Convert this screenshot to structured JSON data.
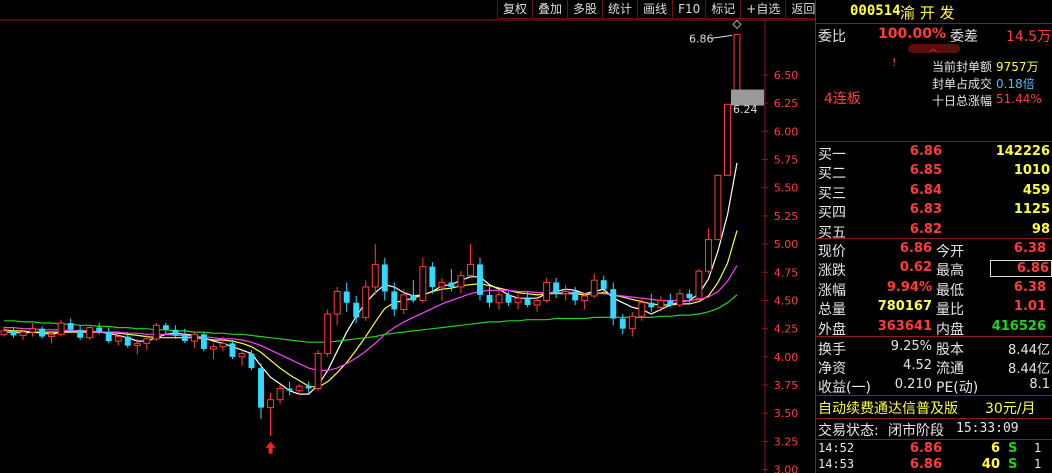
{
  "toolbar": [
    "复权",
    "叠加",
    "多股",
    "统计",
    "画线",
    "F10",
    "标记",
    "+自选",
    "返回"
  ],
  "stock": {
    "code": "000514",
    "name": "渝 开 发"
  },
  "weibi": {
    "label1": "委比",
    "value1": "100.00%",
    "label2": "委差",
    "value2": "14.5万"
  },
  "seal": {
    "board": "4连板",
    "rows": [
      {
        "label": "当前封单额",
        "value": "9757万",
        "color": "yel"
      },
      {
        "label": "封单占成交",
        "value": "0.18倍",
        "color": "cyn"
      },
      {
        "label": "十日总涨幅",
        "value": "51.44%",
        "color": "red"
      }
    ]
  },
  "bids": [
    {
      "label": "买一",
      "price": "6.86",
      "vol": "142226"
    },
    {
      "label": "买二",
      "price": "6.85",
      "vol": "1010"
    },
    {
      "label": "买三",
      "price": "6.84",
      "vol": "459"
    },
    {
      "label": "买四",
      "price": "6.83",
      "vol": "1125"
    },
    {
      "label": "买五",
      "price": "6.82",
      "vol": "98"
    }
  ],
  "quote": [
    {
      "l1": "现价",
      "v1": "6.86",
      "c1": "red",
      "l2": "今开",
      "v2": "6.38",
      "c2": "red"
    },
    {
      "l1": "涨跌",
      "v1": "0.62",
      "c1": "red",
      "l2": "最高",
      "v2": "6.86",
      "c2": "red",
      "box": true
    },
    {
      "l1": "涨幅",
      "v1": "9.94%",
      "c1": "red",
      "l2": "最低",
      "v2": "6.38",
      "c2": "red"
    },
    {
      "l1": "总量",
      "v1": "780167",
      "c1": "yel",
      "l2": "量比",
      "v2": "1.01",
      "c2": "red"
    },
    {
      "l1": "外盘",
      "v1": "363641",
      "c1": "red",
      "l2": "内盘",
      "v2": "416526",
      "c2": "grn"
    }
  ],
  "stats": [
    {
      "l1": "换手",
      "v1": "9.25%",
      "l2": "股本",
      "v2": "8.44亿"
    },
    {
      "l1": "净资",
      "v1": "4.52",
      "l2": "流通",
      "v2": "8.44亿"
    },
    {
      "l1": "收益(一)",
      "v1": "0.210",
      "l2": "PE(动)",
      "v2": "8.1"
    }
  ],
  "promo": {
    "text": "自动续费通达信普及版",
    "price": "30元/月"
  },
  "status": {
    "label": "交易状态:",
    "value": "闭市阶段",
    "time": "15:33:09"
  },
  "ticks": [
    {
      "time": "14:52",
      "price": "6.86",
      "vol": "6",
      "side": "S",
      "dir": "1"
    },
    {
      "time": "14:53",
      "price": "6.86",
      "vol": "40",
      "side": "S",
      "dir": "1"
    }
  ],
  "chart_data": {
    "type": "candlestick",
    "y_ticks": [
      "6.50",
      "6.25",
      "6.00",
      "5.75",
      "5.50",
      "5.25",
      "5.00",
      "4.75",
      "4.50",
      "4.25",
      "4.00",
      "3.75",
      "3.50",
      "3.25",
      "3.00"
    ],
    "ylim": [
      2.97,
      6.97
    ],
    "high_label": "6.86",
    "close_tag": "6.24",
    "candles": [
      [
        4.2,
        4.27,
        4.18,
        4.23
      ],
      [
        4.23,
        4.26,
        4.17,
        4.19
      ],
      [
        4.19,
        4.24,
        4.15,
        4.22
      ],
      [
        4.22,
        4.3,
        4.18,
        4.25
      ],
      [
        4.25,
        4.27,
        4.16,
        4.18
      ],
      [
        4.18,
        4.23,
        4.12,
        4.2
      ],
      [
        4.2,
        4.33,
        4.18,
        4.3
      ],
      [
        4.3,
        4.34,
        4.22,
        4.24
      ],
      [
        4.24,
        4.28,
        4.15,
        4.17
      ],
      [
        4.17,
        4.28,
        4.15,
        4.26
      ],
      [
        4.26,
        4.3,
        4.2,
        4.22
      ],
      [
        4.22,
        4.26,
        4.12,
        4.14
      ],
      [
        4.14,
        4.2,
        4.1,
        4.18
      ],
      [
        4.18,
        4.22,
        4.08,
        4.1
      ],
      [
        4.1,
        4.16,
        4.02,
        4.12
      ],
      [
        4.12,
        4.2,
        4.06,
        4.16
      ],
      [
        4.16,
        4.3,
        4.14,
        4.28
      ],
      [
        4.28,
        4.3,
        4.2,
        4.24
      ],
      [
        4.24,
        4.28,
        4.16,
        4.19
      ],
      [
        4.19,
        4.25,
        4.12,
        4.14
      ],
      [
        4.14,
        4.22,
        4.08,
        4.2
      ],
      [
        4.2,
        4.22,
        4.05,
        4.07
      ],
      [
        4.07,
        4.12,
        3.98,
        4.09
      ],
      [
        4.09,
        4.18,
        4.05,
        4.12
      ],
      [
        4.12,
        4.15,
        3.98,
        4.0
      ],
      [
        4.0,
        4.06,
        3.92,
        4.03
      ],
      [
        4.03,
        4.06,
        3.88,
        3.9
      ],
      [
        3.9,
        3.94,
        3.45,
        3.55
      ],
      [
        3.55,
        3.68,
        3.3,
        3.62
      ],
      [
        3.62,
        3.75,
        3.58,
        3.72
      ],
      [
        3.72,
        3.78,
        3.66,
        3.7
      ],
      [
        3.7,
        3.76,
        3.66,
        3.74
      ],
      [
        3.74,
        3.78,
        3.68,
        3.72
      ],
      [
        3.72,
        4.06,
        3.7,
        4.03
      ],
      [
        4.03,
        4.42,
        4.0,
        4.38
      ],
      [
        4.38,
        4.62,
        4.28,
        4.58
      ],
      [
        4.58,
        4.66,
        4.4,
        4.48
      ],
      [
        4.48,
        4.54,
        4.3,
        4.35
      ],
      [
        4.35,
        4.68,
        4.32,
        4.62
      ],
      [
        4.62,
        5.0,
        4.55,
        4.82
      ],
      [
        4.82,
        4.88,
        4.5,
        4.58
      ],
      [
        4.58,
        4.66,
        4.36,
        4.42
      ],
      [
        4.42,
        4.6,
        4.38,
        4.55
      ],
      [
        4.55,
        4.68,
        4.48,
        4.5
      ],
      [
        4.5,
        4.88,
        4.48,
        4.8
      ],
      [
        4.8,
        4.84,
        4.56,
        4.62
      ],
      [
        4.62,
        4.7,
        4.5,
        4.66
      ],
      [
        4.66,
        4.78,
        4.58,
        4.62
      ],
      [
        4.62,
        4.76,
        4.56,
        4.72
      ],
      [
        4.72,
        5.0,
        4.7,
        4.82
      ],
      [
        4.82,
        4.88,
        4.5,
        4.55
      ],
      [
        4.55,
        4.62,
        4.44,
        4.48
      ],
      [
        4.48,
        4.6,
        4.42,
        4.55
      ],
      [
        4.55,
        4.58,
        4.45,
        4.48
      ],
      [
        4.48,
        4.56,
        4.42,
        4.52
      ],
      [
        4.52,
        4.58,
        4.44,
        4.46
      ],
      [
        4.46,
        4.52,
        4.4,
        4.5
      ],
      [
        4.5,
        4.7,
        4.48,
        4.66
      ],
      [
        4.66,
        4.7,
        4.52,
        4.56
      ],
      [
        4.56,
        4.64,
        4.5,
        4.58
      ],
      [
        4.58,
        4.62,
        4.46,
        4.5
      ],
      [
        4.5,
        4.56,
        4.42,
        4.54
      ],
      [
        4.54,
        4.74,
        4.52,
        4.68
      ],
      [
        4.68,
        4.72,
        4.56,
        4.6
      ],
      [
        4.6,
        4.66,
        4.28,
        4.34
      ],
      [
        4.34,
        4.38,
        4.2,
        4.25
      ],
      [
        4.25,
        4.4,
        4.18,
        4.36
      ],
      [
        4.36,
        4.52,
        4.32,
        4.48
      ],
      [
        4.48,
        4.56,
        4.4,
        4.44
      ],
      [
        4.44,
        4.54,
        4.4,
        4.5
      ],
      [
        4.5,
        4.56,
        4.44,
        4.46
      ],
      [
        4.46,
        4.6,
        4.44,
        4.56
      ],
      [
        4.56,
        4.6,
        4.48,
        4.52
      ],
      [
        4.52,
        4.78,
        4.5,
        4.76
      ],
      [
        4.76,
        5.14,
        4.74,
        5.04
      ],
      [
        5.04,
        5.61,
        5.4,
        5.61
      ],
      [
        5.61,
        6.24,
        5.61,
        6.24
      ],
      [
        6.24,
        6.86,
        6.24,
        6.86
      ]
    ],
    "ma": [
      {
        "color": "#ffffff",
        "values": [
          4.22,
          4.22,
          4.21,
          4.22,
          4.21,
          4.2,
          4.22,
          4.23,
          4.23,
          4.23,
          4.22,
          4.21,
          4.19,
          4.17,
          4.14,
          4.14,
          4.17,
          4.2,
          4.21,
          4.2,
          4.19,
          4.17,
          4.14,
          4.12,
          4.09,
          4.06,
          4.03,
          3.92,
          3.82,
          3.76,
          3.7,
          3.67,
          3.67,
          3.75,
          3.88,
          4.05,
          4.22,
          4.36,
          4.48,
          4.57,
          4.64,
          4.62,
          4.57,
          4.54,
          4.55,
          4.58,
          4.63,
          4.64,
          4.68,
          4.71,
          4.71,
          4.64,
          4.6,
          4.55,
          4.52,
          4.52,
          4.52,
          4.56,
          4.58,
          4.6,
          4.59,
          4.56,
          4.58,
          4.6,
          4.52,
          4.48,
          4.44,
          4.42,
          4.38,
          4.42,
          4.46,
          4.49,
          4.5,
          4.56,
          4.69,
          4.94,
          5.26,
          5.72
        ]
      },
      {
        "color": "#ffff3c",
        "values": [
          4.24,
          4.23,
          4.23,
          4.22,
          4.22,
          4.22,
          4.22,
          4.22,
          4.22,
          4.22,
          4.22,
          4.22,
          4.21,
          4.2,
          4.19,
          4.18,
          4.17,
          4.17,
          4.17,
          4.17,
          4.17,
          4.16,
          4.15,
          4.15,
          4.14,
          4.12,
          4.09,
          4.04,
          3.97,
          3.9,
          3.84,
          3.79,
          3.74,
          3.73,
          3.78,
          3.86,
          3.95,
          4.06,
          4.18,
          4.31,
          4.43,
          4.48,
          4.5,
          4.52,
          4.55,
          4.58,
          4.6,
          4.61,
          4.63,
          4.64,
          4.65,
          4.63,
          4.61,
          4.59,
          4.57,
          4.56,
          4.55,
          4.56,
          4.56,
          4.56,
          4.56,
          4.55,
          4.56,
          4.57,
          4.55,
          4.53,
          4.51,
          4.49,
          4.47,
          4.46,
          4.46,
          4.47,
          4.47,
          4.49,
          4.54,
          4.66,
          4.83,
          5.12
        ]
      },
      {
        "color": "#ff40ff",
        "values": [
          4.26,
          4.26,
          4.25,
          4.25,
          4.24,
          4.24,
          4.24,
          4.23,
          4.23,
          4.23,
          4.22,
          4.22,
          4.22,
          4.21,
          4.21,
          4.2,
          4.2,
          4.2,
          4.19,
          4.19,
          4.18,
          4.18,
          4.17,
          4.16,
          4.16,
          4.15,
          4.13,
          4.1,
          4.06,
          4.02,
          3.98,
          3.94,
          3.9,
          3.88,
          3.88,
          3.9,
          3.94,
          3.99,
          4.05,
          4.12,
          4.2,
          4.26,
          4.31,
          4.35,
          4.39,
          4.43,
          4.47,
          4.5,
          4.53,
          4.56,
          4.58,
          4.59,
          4.59,
          4.59,
          4.58,
          4.58,
          4.57,
          4.57,
          4.57,
          4.57,
          4.57,
          4.56,
          4.56,
          4.56,
          4.55,
          4.54,
          4.53,
          4.52,
          4.51,
          4.5,
          4.5,
          4.5,
          4.5,
          4.51,
          4.53,
          4.58,
          4.67,
          4.81
        ]
      },
      {
        "color": "#1fd41f",
        "values": [
          4.32,
          4.32,
          4.31,
          4.31,
          4.3,
          4.3,
          4.29,
          4.29,
          4.28,
          4.28,
          4.27,
          4.27,
          4.26,
          4.26,
          4.25,
          4.25,
          4.24,
          4.24,
          4.23,
          4.23,
          4.22,
          4.22,
          4.21,
          4.21,
          4.2,
          4.2,
          4.19,
          4.18,
          4.17,
          4.16,
          4.15,
          4.14,
          4.13,
          4.13,
          4.13,
          4.14,
          4.15,
          4.16,
          4.17,
          4.18,
          4.2,
          4.21,
          4.22,
          4.23,
          4.24,
          4.25,
          4.26,
          4.27,
          4.28,
          4.29,
          4.3,
          4.31,
          4.31,
          4.32,
          4.32,
          4.33,
          4.33,
          4.33,
          4.34,
          4.34,
          4.34,
          4.34,
          4.35,
          4.35,
          4.35,
          4.35,
          4.35,
          4.35,
          4.35,
          4.36,
          4.36,
          4.37,
          4.37,
          4.38,
          4.4,
          4.43,
          4.48,
          4.55
        ]
      }
    ]
  }
}
